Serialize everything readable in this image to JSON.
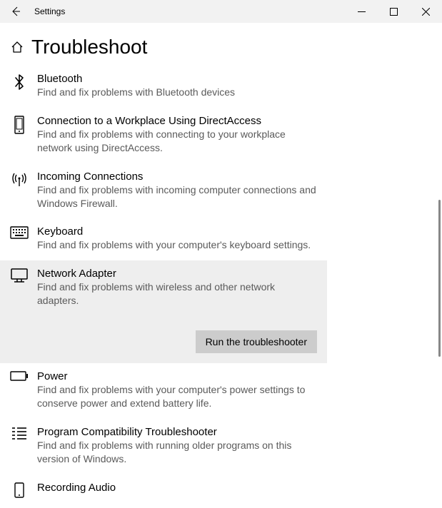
{
  "window": {
    "title": "Settings"
  },
  "page": {
    "heading": "Troubleshoot"
  },
  "items": [
    {
      "id": "bluetooth",
      "title": "Bluetooth",
      "desc": "Find and fix problems with Bluetooth devices"
    },
    {
      "id": "directaccess",
      "title": "Connection to a Workplace Using DirectAccess",
      "desc": "Find and fix problems with connecting to your workplace network using DirectAccess."
    },
    {
      "id": "incoming",
      "title": "Incoming Connections",
      "desc": "Find and fix problems with incoming computer connections and Windows Firewall."
    },
    {
      "id": "keyboard",
      "title": "Keyboard",
      "desc": "Find and fix problems with your computer's keyboard settings."
    },
    {
      "id": "network",
      "title": "Network Adapter",
      "desc": "Find and fix problems with wireless and other network adapters.",
      "selected": true
    },
    {
      "id": "power",
      "title": "Power",
      "desc": "Find and fix problems with your computer's power settings to conserve power and extend battery life."
    },
    {
      "id": "compat",
      "title": "Program Compatibility Troubleshooter",
      "desc": "Find and fix problems with running older programs on this version of Windows."
    },
    {
      "id": "recording",
      "title": "Recording Audio",
      "desc": ""
    }
  ],
  "button": {
    "run": "Run the troubleshooter"
  }
}
